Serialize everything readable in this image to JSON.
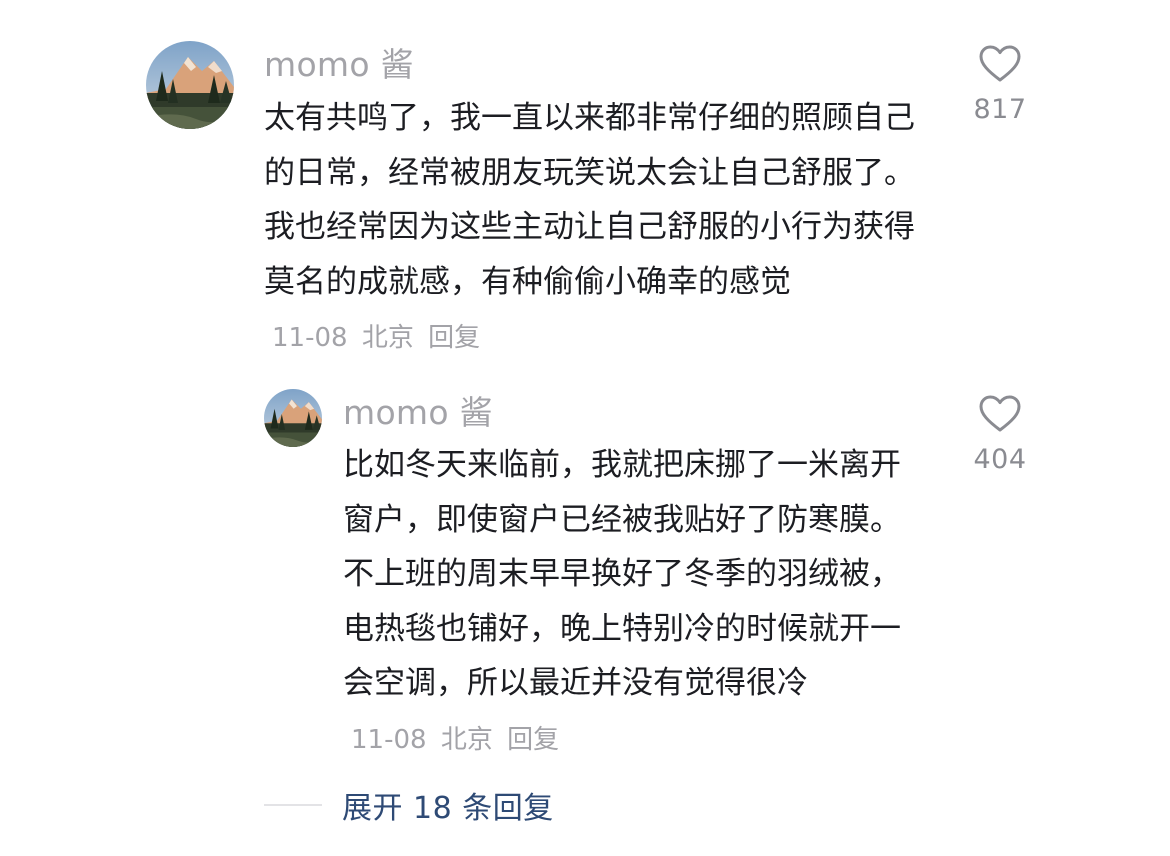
{
  "comments": [
    {
      "username": "momo 酱",
      "text": "太有共鸣了，我一直以来都非常仔细的照顾自己的日常，经常被朋友玩笑说太会让自己舒服了。我也经常因为这些主动让自己舒服的小行为获得莫名的成就感，有种偷偷小确幸的感觉",
      "date": "11-08",
      "location": "北京",
      "reply_label": "回复",
      "likes": "817"
    },
    {
      "username": "momo 酱",
      "text": "比如冬天来临前，我就把床挪了一米离开窗户，即使窗户已经被我贴好了防寒膜。不上班的周末早早换好了冬季的羽绒被，电热毯也铺好，晚上特别冷的时候就开一会空调，所以最近并没有觉得很冷",
      "date": "11-08",
      "location": "北京",
      "reply_label": "回复",
      "likes": "404"
    }
  ],
  "expand_replies": {
    "label": "展开 18 条回复"
  },
  "icons": {
    "like": "heart-outline-icon",
    "avatar": "mountain-landscape-avatar"
  },
  "colors": {
    "username": "#a3a3a8",
    "text": "#1c1d22",
    "meta": "#a3a3a8",
    "expand_link": "#2e4a75"
  }
}
